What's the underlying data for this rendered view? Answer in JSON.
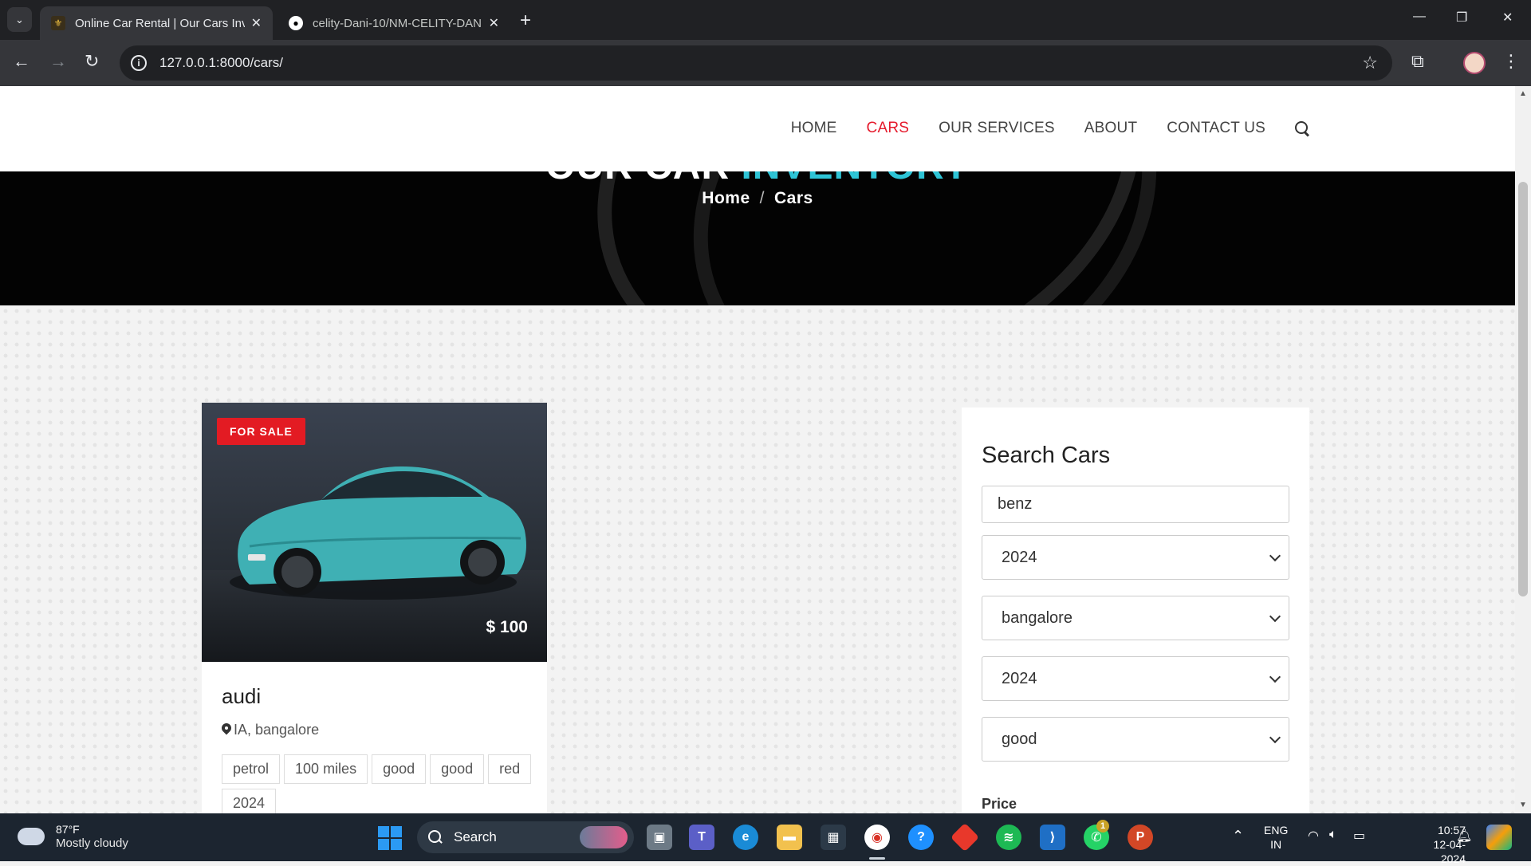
{
  "browser": {
    "tabs": [
      {
        "title": "Online Car Rental | Our Cars Inv",
        "active": true
      },
      {
        "title": "celity-Dani-10/NM-CELITY-DAN",
        "active": false
      }
    ],
    "url": "127.0.0.1:8000/cars/"
  },
  "nav": {
    "items": [
      "HOME",
      "CARS",
      "OUR SERVICES",
      "ABOUT",
      "CONTACT US"
    ],
    "active": "CARS"
  },
  "hero": {
    "title_plain": "OUR CAR ",
    "title_accent": "INVENTORY",
    "breadcrumb": [
      "Home",
      "Cars"
    ],
    "separator": "/"
  },
  "car": {
    "badge": "FOR SALE",
    "price": "$ 100",
    "name": "audi",
    "location": "IA, bangalore",
    "tags": [
      "petrol",
      "100 miles",
      "good",
      "good",
      "red",
      "2024"
    ]
  },
  "search": {
    "title": "Search Cars",
    "keyword": "benz",
    "year": "2024",
    "city": "bangalore",
    "year2": "2024",
    "condition": "good",
    "price_label": "Price"
  },
  "taskbar": {
    "weather_temp": "87°F",
    "weather_desc": "Mostly cloudy",
    "search_label": "Search",
    "lang_top": "ENG",
    "lang_bottom": "IN",
    "time": "10:57",
    "date": "12-04-2024",
    "whatsapp_badge": "1"
  },
  "colors": {
    "accent_red": "#e51a2c",
    "hero_accent": "#2ec4d6",
    "badge_red": "#e31b23"
  }
}
